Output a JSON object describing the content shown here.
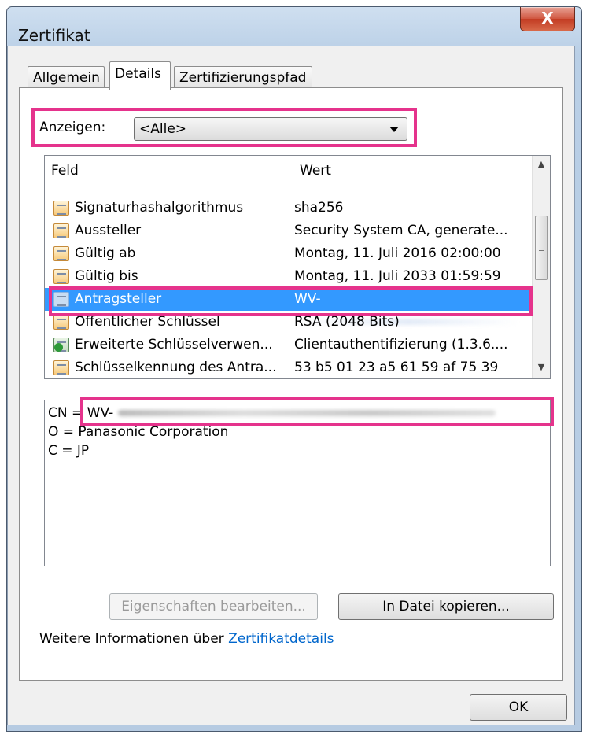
{
  "window": {
    "title": "Zertifikat",
    "close_label": "X"
  },
  "tabs": [
    {
      "label": "Allgemein"
    },
    {
      "label": "Details"
    },
    {
      "label": "Zertifizierungspfad"
    }
  ],
  "filter": {
    "label": "Anzeigen:",
    "selected": "<Alle>"
  },
  "list": {
    "columns": [
      "Feld",
      "Wert"
    ],
    "rows": [
      {
        "field": "Signaturhashalgorithmus",
        "value": "sha256"
      },
      {
        "field": "Aussteller",
        "value": "Security System CA, generate..."
      },
      {
        "field": "Gültig ab",
        "value": "Montag, 11. Juli 2016 02:00:00"
      },
      {
        "field": "Gültig bis",
        "value": "Montag, 11. Juli 2033 01:59:59"
      },
      {
        "field": "Antragsteller",
        "value": "WV-"
      },
      {
        "field": "Öffentlicher Schlüssel",
        "value": "RSA (2048 Bits)"
      },
      {
        "field": "Erweiterte Schlüsselverwen...",
        "value": "Clientauthentifizierung (1.3.6...."
      },
      {
        "field": "Schlüsselkennung des Antra...",
        "value": "53 b5 01 23 a5 61 59 af 75 39"
      }
    ],
    "selected_index": 4
  },
  "detail": {
    "lines": [
      "CN = WV-",
      "O = Panasonic Corporation",
      "C = JP"
    ]
  },
  "buttons": {
    "edit": "Eigenschaften bearbeiten...",
    "copy": "In Datei kopieren...",
    "ok": "OK"
  },
  "info": {
    "text": "Weitere Informationen über ",
    "link": "Zertifikatdetails"
  },
  "colors": {
    "highlight": "#e5338c",
    "selection": "#3399ff",
    "link": "#0066cc"
  }
}
